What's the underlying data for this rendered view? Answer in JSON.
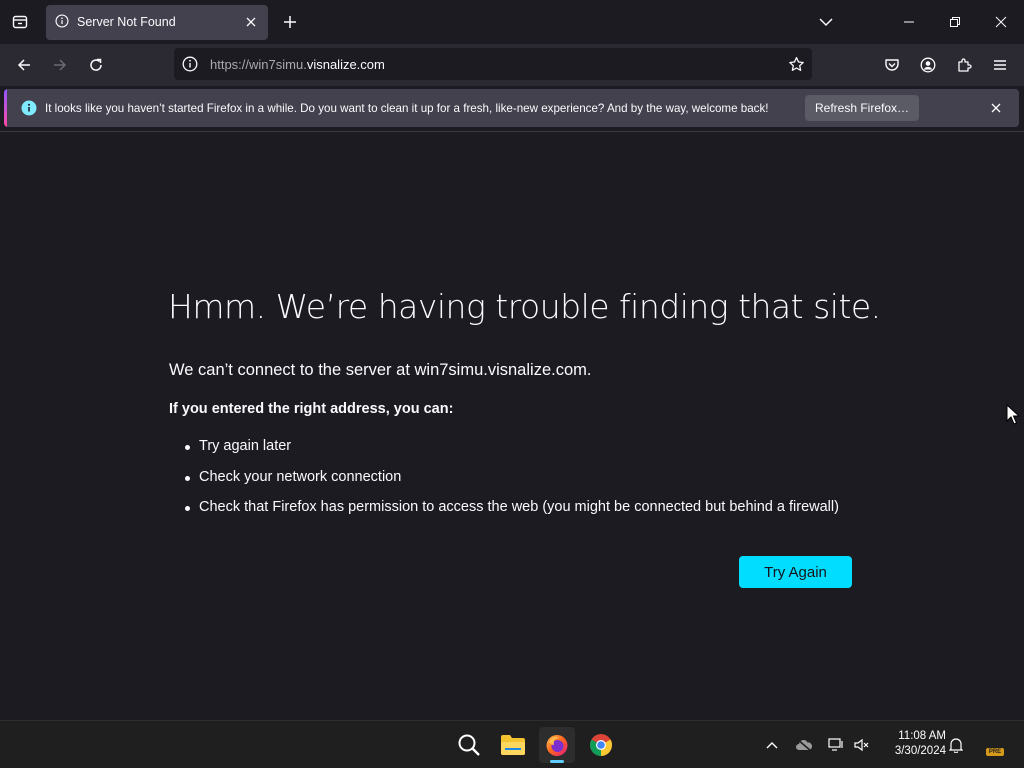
{
  "tab": {
    "title": "Server Not Found"
  },
  "navbar": {
    "url_prefix": "https://win7simu.",
    "url_domain": "visnalize.com"
  },
  "notification": {
    "message": "It looks like you haven’t started Firefox in a while. Do you want to clean it up for a fresh, like-new experience? And by the way, welcome back!",
    "button_label": "Refresh Firefox…"
  },
  "error": {
    "title": "Hmm. We’re having trouble finding that site.",
    "short_desc": "We can’t connect to the server at win7simu.visnalize.com.",
    "intro": "If you entered the right address, you can:",
    "suggestions": [
      "Try again later",
      "Check your network connection",
      "Check that Firefox has permission to access the web (you might be connected but behind a firewall)"
    ],
    "try_again_label": "Try Again"
  },
  "taskbar": {
    "apps": [
      "search-icon",
      "file-explorer-icon",
      "firefox-icon",
      "chrome-icon"
    ],
    "time": "11:08 AM",
    "date": "3/30/2024",
    "badge": "PRE"
  },
  "colors": {
    "accent": "#00ddff",
    "page_bg": "#1c1b22",
    "toolbar_bg": "#2b2a33"
  }
}
